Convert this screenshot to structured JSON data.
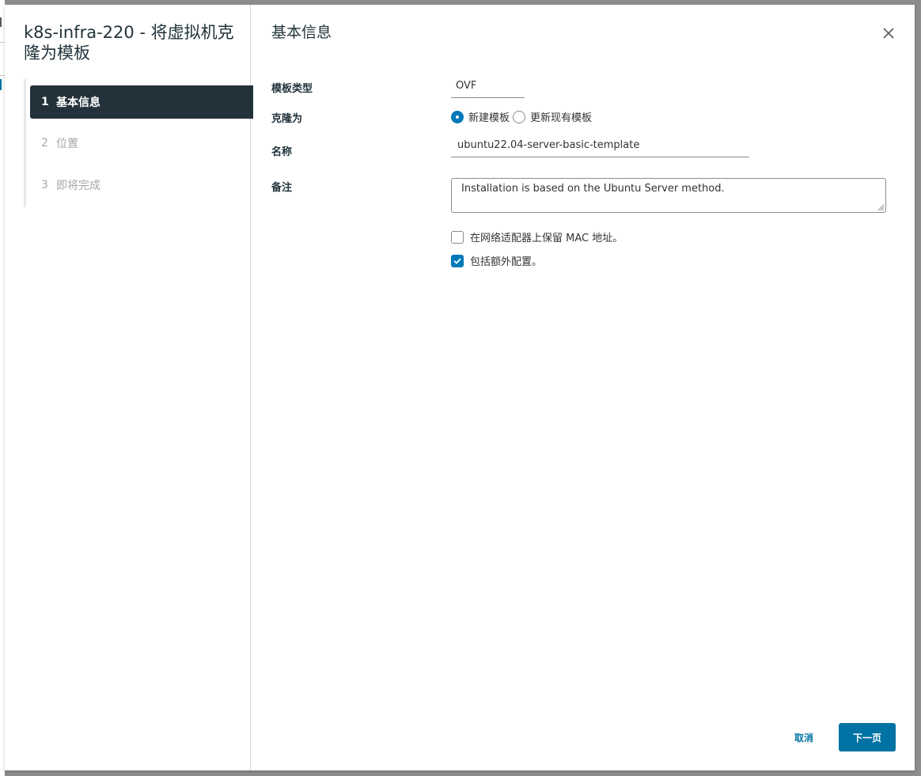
{
  "wizard": {
    "title": "k8s-infra-220 - 将虚拟机克隆为模板",
    "steps": [
      {
        "number": "1",
        "label": "基本信息",
        "active": true
      },
      {
        "number": "2",
        "label": "位置",
        "active": false
      },
      {
        "number": "3",
        "label": "即将完成",
        "active": false
      }
    ]
  },
  "page": {
    "heading": "基本信息",
    "close_icon": "close-icon"
  },
  "form": {
    "template_type": {
      "label": "模板类型",
      "value": "OVF"
    },
    "clone_as": {
      "label": "克隆为",
      "options": [
        {
          "label": "新建模板",
          "selected": true
        },
        {
          "label": "更新现有模板",
          "selected": false
        }
      ]
    },
    "name": {
      "label": "名称",
      "value": "ubuntu22.04-server-basic-template"
    },
    "notes": {
      "label": "备注",
      "value": "Installation is based on the Ubuntu Server method."
    },
    "checkboxes": [
      {
        "label": "在网络适配器上保留 MAC 地址。",
        "checked": false
      },
      {
        "label": "包括额外配置。",
        "checked": true
      }
    ]
  },
  "footer": {
    "cancel_label": "取消",
    "next_label": "下一页"
  },
  "colors": {
    "accent": "#0079b8",
    "primary_button": "#0072a3",
    "active_step_bg": "#22313a",
    "inactive_step_text": "#a7a7a7"
  }
}
